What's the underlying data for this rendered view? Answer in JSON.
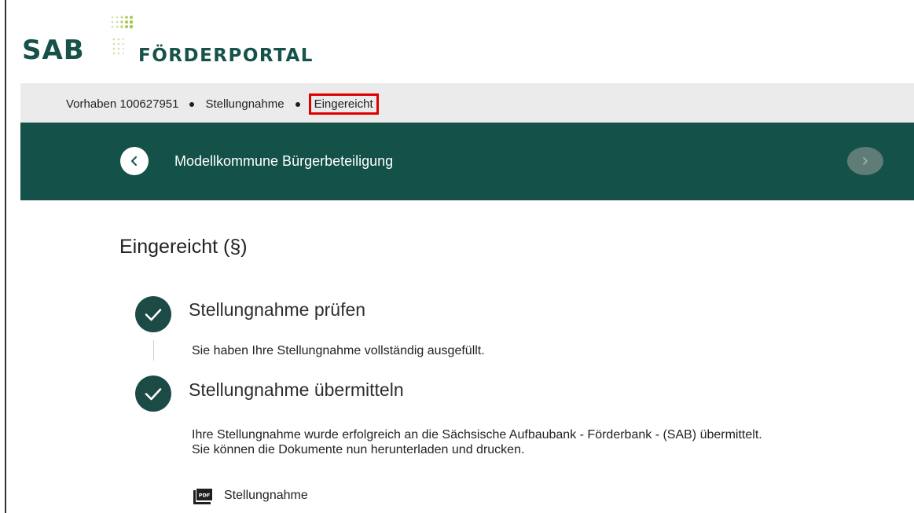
{
  "logo": {
    "sab_text": "SAB",
    "portal_text": "FÖRDERPORTAL",
    "colors": {
      "dark": "#16524a",
      "accent": "#a8c94e"
    }
  },
  "breadcrumb": {
    "items": [
      "Vorhaben 100627951",
      "Stellungnahme",
      "Eingereicht"
    ],
    "highlight_color": "#e00000"
  },
  "header": {
    "title": "Modellkommune Bürgerbeteiligung",
    "back_icon": "chevron-left-icon",
    "forward_icon": "chevron-right-icon",
    "background": "#135149"
  },
  "page": {
    "title": "Eingereicht (§)"
  },
  "steps": [
    {
      "title": "Stellungnahme prüfen",
      "icon": "check-circle-icon",
      "lines": [
        "Sie haben Ihre Stellungnahme vollständig ausgefüllt."
      ]
    },
    {
      "title": "Stellungnahme übermitteln",
      "icon": "check-circle-icon",
      "lines": [
        "Ihre Stellungnahme wurde erfolgreich an die Sächsische Aufbaubank - Förderbank - (SAB) übermittelt.",
        "Sie können die Dokumente nun herunterladen und drucken."
      ]
    }
  ],
  "document": {
    "label": "Stellungnahme",
    "icon": "pdf-icon",
    "icon_text": "PDF"
  }
}
